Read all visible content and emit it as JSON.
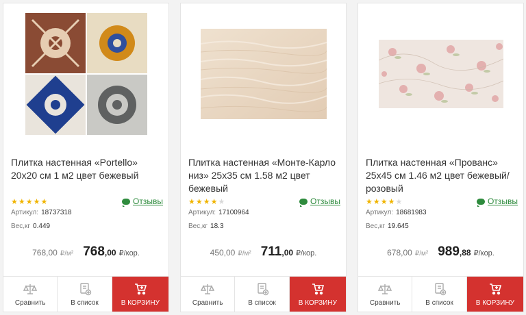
{
  "colors": {
    "accent": "#d4322f",
    "reviews": "#2e8b3d",
    "star": "#f0b400"
  },
  "products": [
    {
      "title": "Плитка настенная «Portello» 20x20 см 1 м2 цвет бежевый",
      "rating": 4.5,
      "reviews_label": "Отзывы",
      "article_label": "Артикул:",
      "article": "18737318",
      "weight_label": "Вес,кг",
      "weight": "0.449",
      "old_price": "768,00",
      "old_unit": "₽/м²",
      "price_int": "768",
      "price_dec": ",00",
      "price_unit": "₽/кор.",
      "compare_label": "Сравнить",
      "list_label": "В список",
      "cart_label": "В КОРЗИНУ"
    },
    {
      "title": "Плитка настенная «Монте-Карло низ» 25x35 см 1.58 м2 цвет бежевый",
      "rating": 3.5,
      "reviews_label": "Отзывы",
      "article_label": "Артикул:",
      "article": "17100964",
      "weight_label": "Вес,кг",
      "weight": "18.3",
      "old_price": "450,00",
      "old_unit": "₽/м²",
      "price_int": "711",
      "price_dec": ",00",
      "price_unit": "₽/кор.",
      "compare_label": "Сравнить",
      "list_label": "В список",
      "cart_label": "В КОРЗИНУ"
    },
    {
      "title": "Плитка настенная «Прованс» 25x45 см 1.46 м2 цвет бежевый/розовый",
      "rating": 4,
      "reviews_label": "Отзывы",
      "article_label": "Артикул:",
      "article": "18681983",
      "weight_label": "Вес,кг",
      "weight": "19.645",
      "old_price": "678,00",
      "old_unit": "₽/м²",
      "price_int": "989",
      "price_dec": ",88",
      "price_unit": "₽/кор.",
      "compare_label": "Сравнить",
      "list_label": "В список",
      "cart_label": "В КОРЗИНУ"
    }
  ]
}
